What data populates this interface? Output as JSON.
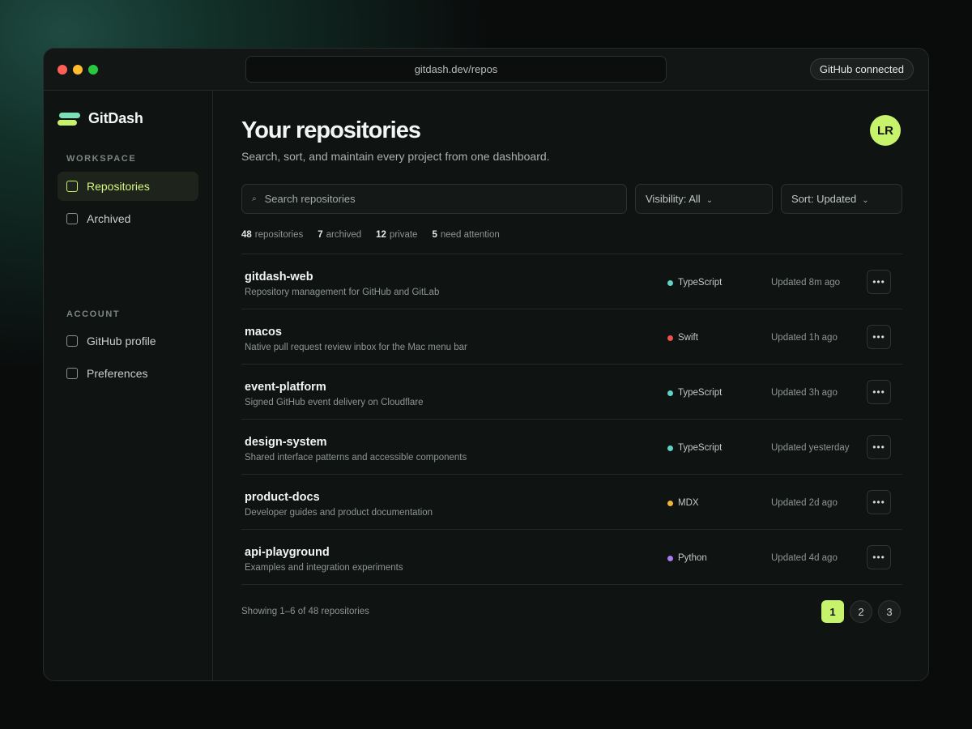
{
  "window": {
    "url": "gitdash.dev/repos",
    "github_status": "GitHub connected"
  },
  "sidebar": {
    "brand": "GitDash",
    "workspace_label": "WORKSPACE",
    "workspace_items": [
      {
        "label": "Repositories",
        "active": true
      },
      {
        "label": "Archived",
        "active": false
      }
    ],
    "account_label": "ACCOUNT",
    "account_items": [
      {
        "label": "GitHub profile"
      },
      {
        "label": "Preferences"
      }
    ]
  },
  "header": {
    "title": "Your repositories",
    "subtitle": "Search, sort, and maintain every project from one dashboard.",
    "avatar_initials": "LR"
  },
  "toolbar": {
    "search_placeholder": "Search repositories",
    "search_icon": "search-icon",
    "visibility": "Visibility: All",
    "sort": "Sort: Updated"
  },
  "stats": [
    {
      "value": "48",
      "label": "repositories"
    },
    {
      "value": "7",
      "label": "archived"
    },
    {
      "value": "12",
      "label": "private"
    },
    {
      "value": "5",
      "label": "need attention"
    }
  ],
  "colors": {
    "accent": "#c6f36b",
    "typescript": "#5fd3c6",
    "swift": "#f0524a",
    "mdx": "#f0b43c",
    "python": "#a97cf2"
  },
  "repos": [
    {
      "name": "gitdash-web",
      "description": "Repository management for GitHub and GitLab",
      "language": "TypeScript",
      "lang_color": "#5fd3c6",
      "updated": "Updated 8m ago"
    },
    {
      "name": "macos",
      "description": "Native pull request review inbox for the Mac menu bar",
      "language": "Swift",
      "lang_color": "#f0524a",
      "updated": "Updated 1h ago"
    },
    {
      "name": "event-platform",
      "description": "Signed GitHub event delivery on Cloudflare",
      "language": "TypeScript",
      "lang_color": "#5fd3c6",
      "updated": "Updated 3h ago"
    },
    {
      "name": "design-system",
      "description": "Shared interface patterns and accessible components",
      "language": "TypeScript",
      "lang_color": "#5fd3c6",
      "updated": "Updated yesterday"
    },
    {
      "name": "product-docs",
      "description": "Developer guides and product documentation",
      "language": "MDX",
      "lang_color": "#f0b43c",
      "updated": "Updated 2d ago"
    },
    {
      "name": "api-playground",
      "description": "Examples and integration experiments",
      "language": "Python",
      "lang_color": "#a97cf2",
      "updated": "Updated 4d ago"
    }
  ],
  "footer": {
    "showing": "Showing 1–6 of 48 repositories",
    "pages": [
      "1",
      "2",
      "3"
    ],
    "current_page": "1"
  }
}
